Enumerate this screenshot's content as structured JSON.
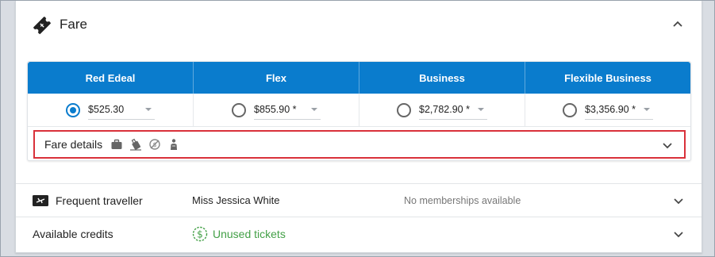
{
  "fare": {
    "title": "Fare",
    "columns": [
      {
        "name": "Red Edeal",
        "price": "$525.30",
        "selected": true
      },
      {
        "name": "Flex",
        "price": "$855.90 *",
        "selected": false
      },
      {
        "name": "Business",
        "price": "$2,782.90 *",
        "selected": false
      },
      {
        "name": "Flexible Business",
        "price": "$3,356.90 *",
        "selected": false
      }
    ],
    "details_label": "Fare details",
    "details_icons": [
      "briefcase-icon",
      "luggage-icon",
      "no-refund-icon",
      "seat-person-icon"
    ]
  },
  "frequent_traveller": {
    "label": "Frequent traveller",
    "name": "Miss Jessica White",
    "memberships": "No memberships available"
  },
  "available_credits": {
    "label": "Available credits",
    "link": "Unused tickets"
  },
  "colors": {
    "accent": "#0a7ccd",
    "highlight_border": "#d9313a",
    "credit_green": "#43a047"
  }
}
